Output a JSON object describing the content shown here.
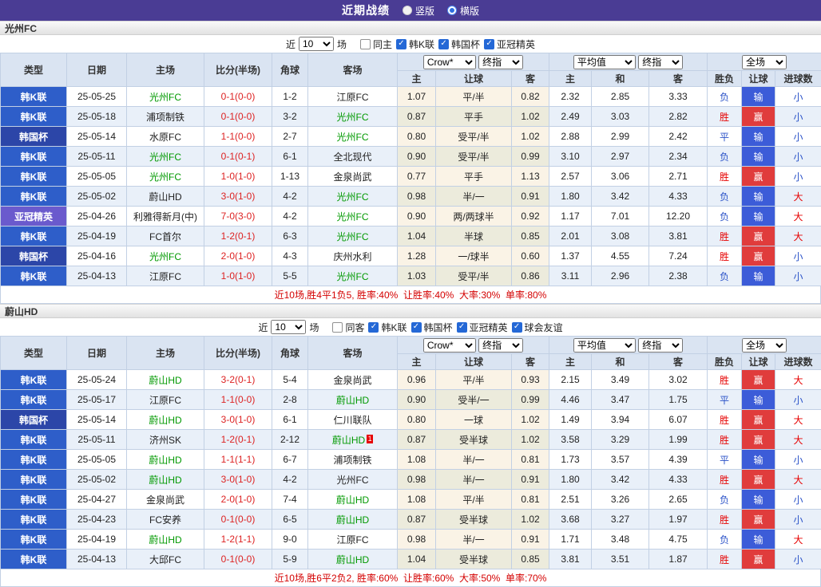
{
  "colors": {
    "accent_purple": "#4a3c94",
    "league": {
      "韩K联": "#2e5ec9",
      "韩国杯": "#2c46a8",
      "亚冠精英": "#6a5acd"
    },
    "focus_team": "#009900",
    "score_red": "#dd2222",
    "win_text": "#e60000",
    "lose_text": "#2a52c8",
    "win_bg": "#e03c3c",
    "lose_bg": "#3c5cd8",
    "summary_red": "#d40000"
  },
  "topbar": {
    "title": "近期战绩",
    "radios": [
      {
        "label": "竖版",
        "selected": false
      },
      {
        "label": "横版",
        "selected": true
      }
    ]
  },
  "columns": {
    "type": "类型",
    "date": "日期",
    "home": "主场",
    "score": "比分(半场)",
    "corner": "角球",
    "away": "客场",
    "asian_home": "主",
    "asian_handicap": "让球",
    "asian_away": "客",
    "euro_home": "主",
    "euro_draw": "和",
    "euro_away": "客",
    "result_wdl": "胜负",
    "result_handicap": "让球",
    "result_goals": "进球数"
  },
  "dropdowns": {
    "asian_provider": "Crow*",
    "asian_final": "终指",
    "euro_provider": "平均值",
    "euro_final": "终指",
    "scope": "全场"
  },
  "filter_labels": {
    "prefix": "近",
    "suffix": "场"
  },
  "sections": [
    {
      "team": "光州FC",
      "filter": {
        "count": "10",
        "checkboxes": [
          {
            "label": "同主",
            "checked": false
          },
          {
            "label": "韩K联",
            "checked": true
          },
          {
            "label": "韩国杯",
            "checked": true
          },
          {
            "label": "亚冠精英",
            "checked": true
          }
        ]
      },
      "rows": [
        {
          "type": "韩K联",
          "date": "25-05-25",
          "home": "光州FC",
          "home_focus": true,
          "score": "0-1(0-0)",
          "corner": "1-2",
          "away": "江原FC",
          "away_focus": false,
          "asian_home": "1.07",
          "asian_hcap": "平/半",
          "asian_away": "0.82",
          "euro_home": "2.32",
          "euro_draw": "2.85",
          "euro_away": "3.33",
          "res_wdl": "负",
          "res_hcap": "输",
          "res_goals": "小"
        },
        {
          "type": "韩K联",
          "date": "25-05-18",
          "home": "浦项制铁",
          "home_focus": false,
          "score": "0-1(0-0)",
          "corner": "3-2",
          "away": "光州FC",
          "away_focus": true,
          "asian_home": "0.87",
          "asian_hcap": "平手",
          "asian_away": "1.02",
          "euro_home": "2.49",
          "euro_draw": "3.03",
          "euro_away": "2.82",
          "res_wdl": "胜",
          "res_hcap": "赢",
          "res_goals": "小"
        },
        {
          "type": "韩国杯",
          "date": "25-05-14",
          "home": "水原FC",
          "home_focus": false,
          "score": "1-1(0-0)",
          "corner": "2-7",
          "away": "光州FC",
          "away_focus": true,
          "asian_home": "0.80",
          "asian_hcap": "受平/半",
          "asian_away": "1.02",
          "euro_home": "2.88",
          "euro_draw": "2.99",
          "euro_away": "2.42",
          "res_wdl": "平",
          "res_hcap": "输",
          "res_goals": "小"
        },
        {
          "type": "韩K联",
          "date": "25-05-11",
          "home": "光州FC",
          "home_focus": true,
          "score": "0-1(0-1)",
          "corner": "6-1",
          "away": "全北现代",
          "away_focus": false,
          "asian_home": "0.90",
          "asian_hcap": "受平/半",
          "asian_away": "0.99",
          "euro_home": "3.10",
          "euro_draw": "2.97",
          "euro_away": "2.34",
          "res_wdl": "负",
          "res_hcap": "输",
          "res_goals": "小"
        },
        {
          "type": "韩K联",
          "date": "25-05-05",
          "home": "光州FC",
          "home_focus": true,
          "score": "1-0(1-0)",
          "corner": "1-13",
          "away": "金泉尚武",
          "away_focus": false,
          "asian_home": "0.77",
          "asian_hcap": "平手",
          "asian_away": "1.13",
          "euro_home": "2.57",
          "euro_draw": "3.06",
          "euro_away": "2.71",
          "res_wdl": "胜",
          "res_hcap": "赢",
          "res_goals": "小"
        },
        {
          "type": "韩K联",
          "date": "25-05-02",
          "home": "蔚山HD",
          "home_focus": false,
          "score": "3-0(1-0)",
          "corner": "4-2",
          "away": "光州FC",
          "away_focus": true,
          "asian_home": "0.98",
          "asian_hcap": "半/一",
          "asian_away": "0.91",
          "euro_home": "1.80",
          "euro_draw": "3.42",
          "euro_away": "4.33",
          "res_wdl": "负",
          "res_hcap": "输",
          "res_goals": "大"
        },
        {
          "type": "亚冠精英",
          "date": "25-04-26",
          "home": "利雅得新月(中)",
          "home_focus": false,
          "score": "7-0(3-0)",
          "corner": "4-2",
          "away": "光州FC",
          "away_focus": true,
          "asian_home": "0.90",
          "asian_hcap": "两/两球半",
          "asian_away": "0.92",
          "euro_home": "1.17",
          "euro_draw": "7.01",
          "euro_away": "12.20",
          "res_wdl": "负",
          "res_hcap": "输",
          "res_goals": "大"
        },
        {
          "type": "韩K联",
          "date": "25-04-19",
          "home": "FC首尔",
          "home_focus": false,
          "score": "1-2(0-1)",
          "corner": "6-3",
          "away": "光州FC",
          "away_focus": true,
          "asian_home": "1.04",
          "asian_hcap": "半球",
          "asian_away": "0.85",
          "euro_home": "2.01",
          "euro_draw": "3.08",
          "euro_away": "3.81",
          "res_wdl": "胜",
          "res_hcap": "赢",
          "res_goals": "大"
        },
        {
          "type": "韩国杯",
          "date": "25-04-16",
          "home": "光州FC",
          "home_focus": true,
          "score": "2-0(1-0)",
          "corner": "4-3",
          "away": "庆州水利",
          "away_focus": false,
          "asian_home": "1.28",
          "asian_hcap": "一/球半",
          "asian_away": "0.60",
          "euro_home": "1.37",
          "euro_draw": "4.55",
          "euro_away": "7.24",
          "res_wdl": "胜",
          "res_hcap": "赢",
          "res_goals": "小"
        },
        {
          "type": "韩K联",
          "date": "25-04-13",
          "home": "江原FC",
          "home_focus": false,
          "score": "1-0(1-0)",
          "corner": "5-5",
          "away": "光州FC",
          "away_focus": true,
          "asian_home": "1.03",
          "asian_hcap": "受平/半",
          "asian_away": "0.86",
          "euro_home": "3.11",
          "euro_draw": "2.96",
          "euro_away": "2.38",
          "res_wdl": "负",
          "res_hcap": "输",
          "res_goals": "小"
        }
      ],
      "summary": "近10场,胜4平1负5, 胜率:40%  让胜率:40%  大率:30%  单率:80%"
    },
    {
      "team": "蔚山HD",
      "filter": {
        "count": "10",
        "checkboxes": [
          {
            "label": "同客",
            "checked": false
          },
          {
            "label": "韩K联",
            "checked": true
          },
          {
            "label": "韩国杯",
            "checked": true
          },
          {
            "label": "亚冠精英",
            "checked": true
          },
          {
            "label": "球会友谊",
            "checked": true
          }
        ]
      },
      "rows": [
        {
          "type": "韩K联",
          "date": "25-05-24",
          "home": "蔚山HD",
          "home_focus": true,
          "score": "3-2(0-1)",
          "corner": "5-4",
          "away": "金泉尚武",
          "away_focus": false,
          "asian_home": "0.96",
          "asian_hcap": "平/半",
          "asian_away": "0.93",
          "euro_home": "2.15",
          "euro_draw": "3.49",
          "euro_away": "3.02",
          "res_wdl": "胜",
          "res_hcap": "赢",
          "res_goals": "大"
        },
        {
          "type": "韩K联",
          "date": "25-05-17",
          "home": "江原FC",
          "home_focus": false,
          "score": "1-1(0-0)",
          "corner": "2-8",
          "away": "蔚山HD",
          "away_focus": true,
          "asian_home": "0.90",
          "asian_hcap": "受半/一",
          "asian_away": "0.99",
          "euro_home": "4.46",
          "euro_draw": "3.47",
          "euro_away": "1.75",
          "res_wdl": "平",
          "res_hcap": "输",
          "res_goals": "小"
        },
        {
          "type": "韩国杯",
          "date": "25-05-14",
          "home": "蔚山HD",
          "home_focus": true,
          "score": "3-0(1-0)",
          "corner": "6-1",
          "away": "仁川联队",
          "away_focus": false,
          "asian_home": "0.80",
          "asian_hcap": "一球",
          "asian_away": "1.02",
          "euro_home": "1.49",
          "euro_draw": "3.94",
          "euro_away": "6.07",
          "res_wdl": "胜",
          "res_hcap": "赢",
          "res_goals": "大"
        },
        {
          "type": "韩K联",
          "date": "25-05-11",
          "home": "济州SK",
          "home_focus": false,
          "score": "1-2(0-1)",
          "corner": "2-12",
          "away": "蔚山HD",
          "away_focus": true,
          "away_card": "1",
          "asian_home": "0.87",
          "asian_hcap": "受半球",
          "asian_away": "1.02",
          "euro_home": "3.58",
          "euro_draw": "3.29",
          "euro_away": "1.99",
          "res_wdl": "胜",
          "res_hcap": "赢",
          "res_goals": "大"
        },
        {
          "type": "韩K联",
          "date": "25-05-05",
          "home": "蔚山HD",
          "home_focus": true,
          "score": "1-1(1-1)",
          "corner": "6-7",
          "away": "浦项制铁",
          "away_focus": false,
          "asian_home": "1.08",
          "asian_hcap": "半/一",
          "asian_away": "0.81",
          "euro_home": "1.73",
          "euro_draw": "3.57",
          "euro_away": "4.39",
          "res_wdl": "平",
          "res_hcap": "输",
          "res_goals": "小"
        },
        {
          "type": "韩K联",
          "date": "25-05-02",
          "home": "蔚山HD",
          "home_focus": true,
          "score": "3-0(1-0)",
          "corner": "4-2",
          "away": "光州FC",
          "away_focus": false,
          "asian_home": "0.98",
          "asian_hcap": "半/一",
          "asian_away": "0.91",
          "euro_home": "1.80",
          "euro_draw": "3.42",
          "euro_away": "4.33",
          "res_wdl": "胜",
          "res_hcap": "赢",
          "res_goals": "大"
        },
        {
          "type": "韩K联",
          "date": "25-04-27",
          "home": "金泉尚武",
          "home_focus": false,
          "score": "2-0(1-0)",
          "corner": "7-4",
          "away": "蔚山HD",
          "away_focus": true,
          "asian_home": "1.08",
          "asian_hcap": "平/半",
          "asian_away": "0.81",
          "euro_home": "2.51",
          "euro_draw": "3.26",
          "euro_away": "2.65",
          "res_wdl": "负",
          "res_hcap": "输",
          "res_goals": "小"
        },
        {
          "type": "韩K联",
          "date": "25-04-23",
          "home": "FC安养",
          "home_focus": false,
          "score": "0-1(0-0)",
          "corner": "6-5",
          "away": "蔚山HD",
          "away_focus": true,
          "asian_home": "0.87",
          "asian_hcap": "受半球",
          "asian_away": "1.02",
          "euro_home": "3.68",
          "euro_draw": "3.27",
          "euro_away": "1.97",
          "res_wdl": "胜",
          "res_hcap": "赢",
          "res_goals": "小"
        },
        {
          "type": "韩K联",
          "date": "25-04-19",
          "home": "蔚山HD",
          "home_focus": true,
          "score": "1-2(1-1)",
          "corner": "9-0",
          "away": "江原FC",
          "away_focus": false,
          "asian_home": "0.98",
          "asian_hcap": "半/一",
          "asian_away": "0.91",
          "euro_home": "1.71",
          "euro_draw": "3.48",
          "euro_away": "4.75",
          "res_wdl": "负",
          "res_hcap": "输",
          "res_goals": "大"
        },
        {
          "type": "韩K联",
          "date": "25-04-13",
          "home": "大邱FC",
          "home_focus": false,
          "score": "0-1(0-0)",
          "corner": "5-9",
          "away": "蔚山HD",
          "away_focus": true,
          "asian_home": "1.04",
          "asian_hcap": "受半球",
          "asian_away": "0.85",
          "euro_home": "3.81",
          "euro_draw": "3.51",
          "euro_away": "1.87",
          "res_wdl": "胜",
          "res_hcap": "赢",
          "res_goals": "小"
        }
      ],
      "summary": "近10场,胜6平2负2, 胜率:60%  让胜率:60%  大率:50%  单率:70%"
    }
  ]
}
